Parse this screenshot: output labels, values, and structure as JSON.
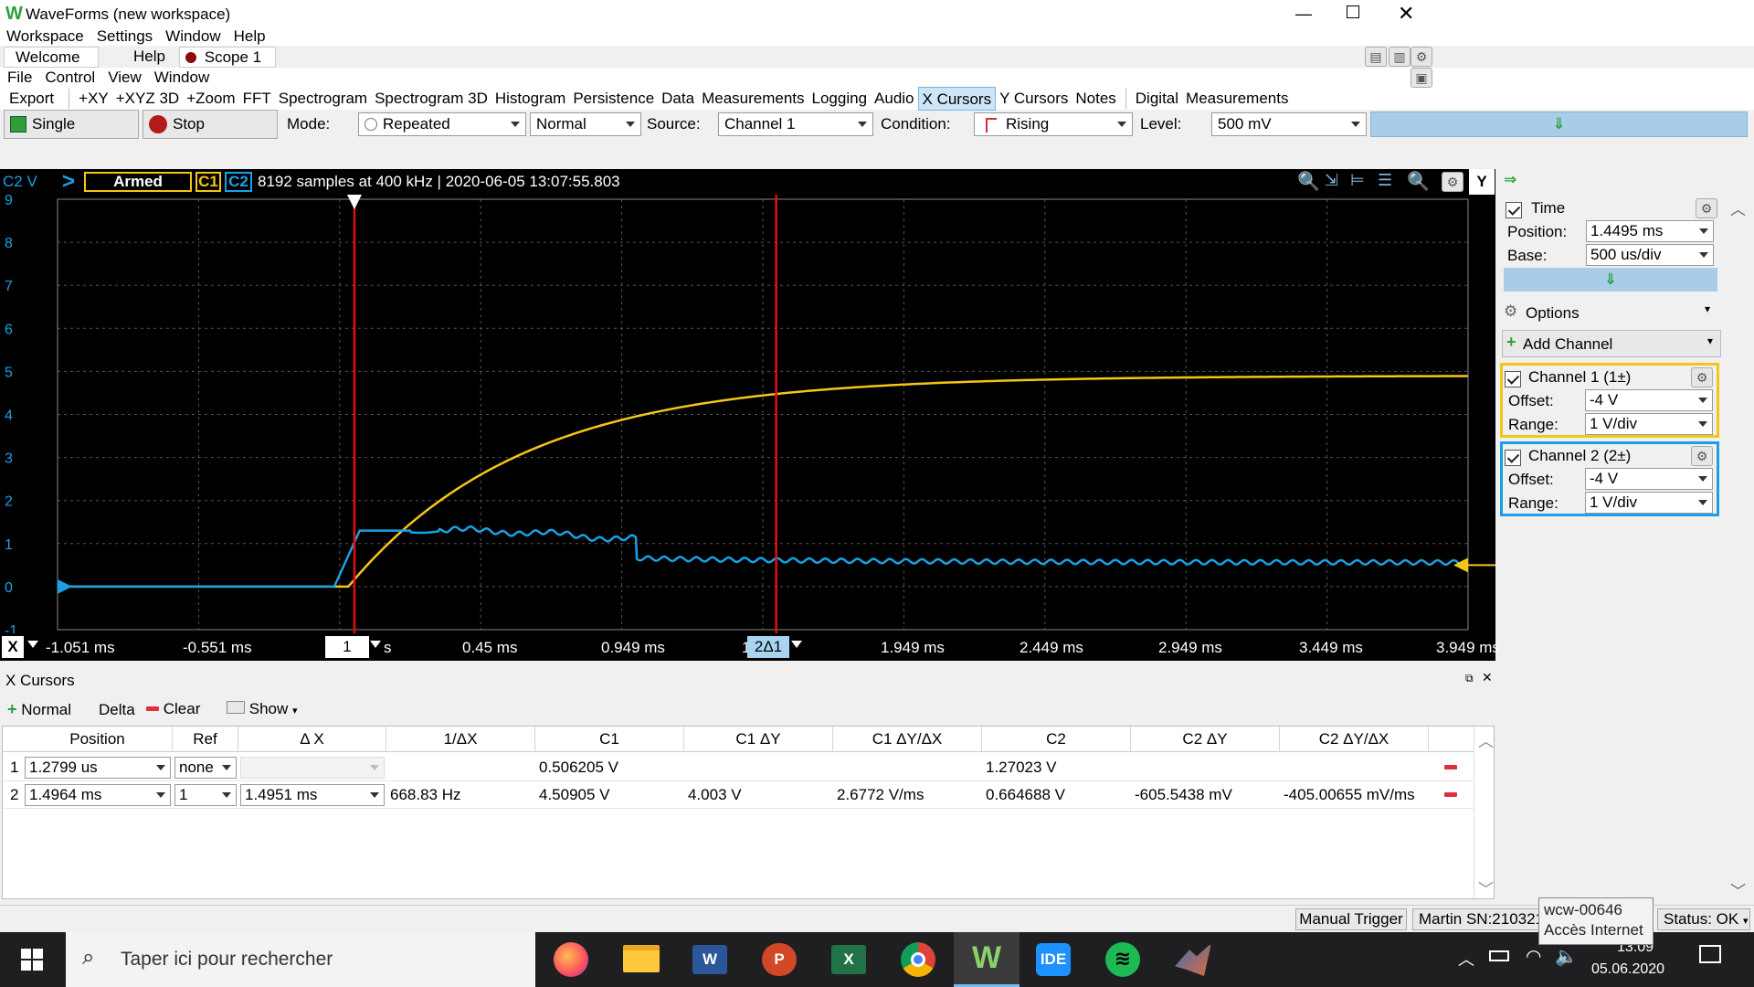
{
  "window": {
    "title": "WaveForms (new workspace)"
  },
  "menu": [
    "Workspace",
    "Settings",
    "Window",
    "Help"
  ],
  "tabs": [
    {
      "label": "Welcome"
    },
    {
      "label": "Help"
    },
    {
      "label": "Scope 1"
    }
  ],
  "scope_menu": [
    "File",
    "Control",
    "View",
    "Window"
  ],
  "tools": [
    "Export",
    "+XY",
    "+XYZ 3D",
    "+Zoom",
    "FFT",
    "Spectrogram",
    "Spectrogram 3D",
    "Histogram",
    "Persistence",
    "Data",
    "Measurements",
    "Logging",
    "Audio",
    "X Cursors",
    "Y Cursors",
    "Notes",
    "Digital",
    "Measurements"
  ],
  "acq": {
    "single_label": "Single",
    "stop_label": "Stop",
    "mode_label": "Mode:",
    "mode_value": "Repeated",
    "mode2_value": "Normal",
    "source_label": "Source:",
    "source_value": "Channel 1",
    "condition_label": "Condition:",
    "condition_value": "Rising",
    "level_label": "Level:",
    "level_value": "500 mV"
  },
  "plot_header": {
    "ch_label": "C2 V",
    "status": "Armed",
    "c1": "C1",
    "c2": "C2",
    "info": "8192 samples at 400 kHz | 2020-06-05 13:07:55.803",
    "y_btn": "Y"
  },
  "y_ticks": [
    "9",
    "8",
    "7",
    "6",
    "5",
    "4",
    "3",
    "2",
    "1",
    "0",
    "-1"
  ],
  "x_axis": {
    "x_btn": "X",
    "ticks": [
      "-1.051 ms",
      "-0.551 ms",
      "0.45 ms",
      "0.949 ms",
      "1.949 ms",
      "2.449 ms",
      "2.949 ms",
      "3.449 ms",
      "3.949 ms"
    ],
    "cursor1_tag": "1",
    "cursor1_tail": "s",
    "cursor2_tag": "2Δ1",
    "cursor2_prefix": "1"
  },
  "right_panel": {
    "time_label": "Time",
    "position_label": "Position:",
    "position_value": "1.4495 ms",
    "base_label": "Base:",
    "base_value": "500 us/div",
    "options_label": "Options",
    "add_channel_label": "Add Channel",
    "channels": [
      {
        "name": "Channel 1 (1±)",
        "offset_label": "Offset:",
        "offset": "-4 V",
        "range_label": "Range:",
        "range": "1 V/div",
        "color": "#f5c518"
      },
      {
        "name": "Channel 2 (2±)",
        "offset_label": "Offset:",
        "offset": "-4 V",
        "range_label": "Range:",
        "range": "1 V/div",
        "color": "#1ba1e2"
      }
    ]
  },
  "xcursors": {
    "title": "X Cursors",
    "normal_label": "Normal",
    "delta_label": "Delta",
    "clear_label": "Clear",
    "show_label": "Show",
    "columns": [
      "Position",
      "Ref",
      "Δ X",
      "1/ΔX",
      "C1",
      "C1 ΔY",
      "C1 ΔY/ΔX",
      "C2",
      "C2 ΔY",
      "C2 ΔY/ΔX"
    ],
    "rows": [
      {
        "idx": "1",
        "position": "1.2799 us",
        "ref": "none",
        "dx": "",
        "inv": "",
        "c1": "0.506205 V",
        "c1dy": "",
        "c1dydx": "",
        "c2": "1.27023 V",
        "c2dy": "",
        "c2dydx": ""
      },
      {
        "idx": "2",
        "position": "1.4964 ms",
        "ref": "1",
        "dx": "1.4951 ms",
        "inv": "668.83 Hz",
        "c1": "4.50905 V",
        "c1dy": "4.003 V",
        "c1dydx": "2.6772 V/ms",
        "c2": "0.664688 V",
        "c2dy": "-605.5438 mV",
        "c2dydx": "-405.00655 mV/ms"
      }
    ]
  },
  "statusbar": {
    "manual_trigger": "Manual Trigger",
    "device": "Martin SN:210321",
    "status": "Status: OK"
  },
  "tooltip": {
    "line1": "wcw-00646",
    "line2": "Accès Internet"
  },
  "taskbar": {
    "search_placeholder": "Taper ici pour rechercher",
    "time": "13:09",
    "date": "05.06.2020"
  },
  "colors": {
    "c1": "#f5c518",
    "c2": "#1ba1e2",
    "cursor": "#e01010",
    "plot_bg": "#000000"
  }
}
